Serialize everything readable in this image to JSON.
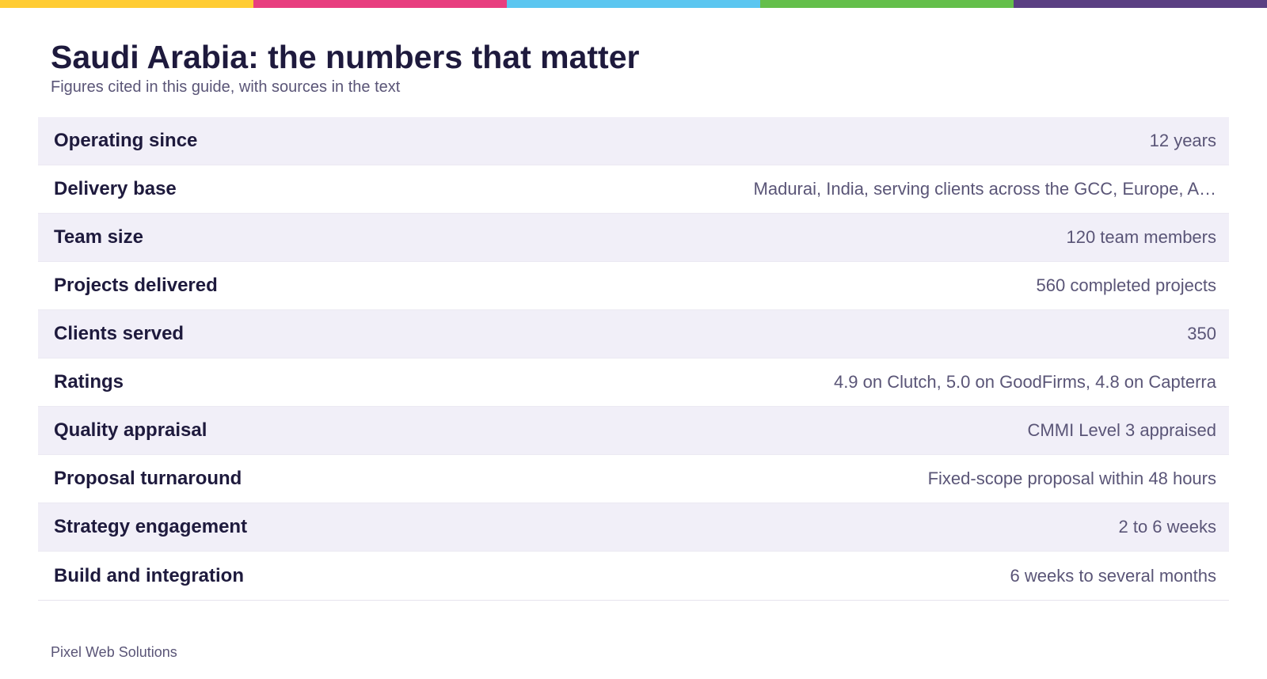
{
  "accent_colors": [
    "#ffcc33",
    "#e83e7f",
    "#5bc6f0",
    "#64bf4b",
    "#5a3f82"
  ],
  "header": {
    "title": "Saudi Arabia: the numbers that matter",
    "subtitle": "Figures cited in this guide, with sources in the text"
  },
  "rows": [
    {
      "label": "Operating since",
      "value": "12 years"
    },
    {
      "label": "Delivery base",
      "value": "Madurai, India, serving clients across the GCC, Europe, A…"
    },
    {
      "label": "Team size",
      "value": "120 team members"
    },
    {
      "label": "Projects delivered",
      "value": "560 completed projects"
    },
    {
      "label": "Clients served",
      "value": "350"
    },
    {
      "label": "Ratings",
      "value": "4.9 on Clutch, 5.0 on GoodFirms, 4.8 on Capterra"
    },
    {
      "label": "Quality appraisal",
      "value": "CMMI Level 3 appraised"
    },
    {
      "label": "Proposal turnaround",
      "value": "Fixed-scope proposal within 48 hours"
    },
    {
      "label": "Strategy engagement",
      "value": "2 to 6 weeks"
    },
    {
      "label": "Build and integration",
      "value": "6 weeks to several months"
    }
  ],
  "footer": {
    "brand": "Pixel Web Solutions"
  }
}
